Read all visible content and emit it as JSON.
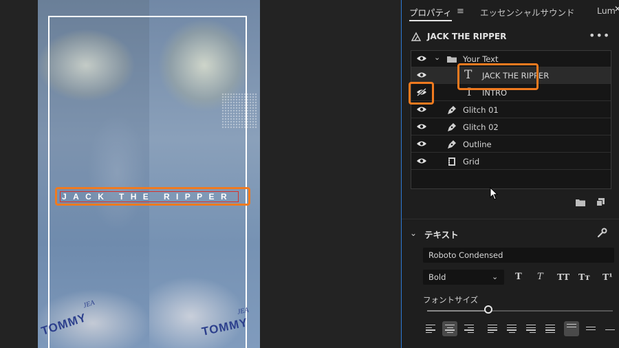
{
  "monitor": {
    "overlay_title": "JACK THE RIPPER",
    "shirt_brand_left": "TOMMY",
    "shirt_brand_right": "TOMMY",
    "shirt_sub_left": "JEA",
    "shirt_sub_right": "JEA"
  },
  "panel": {
    "tabs": [
      {
        "label": "プロパティ",
        "active": true
      },
      {
        "label": "エッセンシャルサウンド",
        "active": false
      },
      {
        "label": "Lum",
        "active": false
      }
    ],
    "tab_menu_icon": "hamburger-menu-icon",
    "tab_close_icon": "close-icon",
    "clip_name": "JACK THE RIPPER",
    "clip_more_label": "•••",
    "layers": [
      {
        "label": "Your Text",
        "type": "folder",
        "visible": true,
        "expanded": true,
        "selected": false
      },
      {
        "label": "JACK THE RIPPER",
        "type": "text",
        "visible": true,
        "selected": true
      },
      {
        "label": "INTRO",
        "type": "text",
        "visible": false,
        "selected": false
      },
      {
        "label": "Glitch 01",
        "type": "shape",
        "visible": true,
        "selected": false
      },
      {
        "label": "Glitch 02",
        "type": "shape",
        "visible": true,
        "selected": false
      },
      {
        "label": "Outline",
        "type": "shape",
        "visible": true,
        "selected": false
      },
      {
        "label": "Grid",
        "type": "clip",
        "visible": true,
        "selected": false
      }
    ],
    "text_section": {
      "title": "テキスト",
      "font_family": "Roboto Condensed",
      "font_style": "Bold",
      "format_buttons": [
        "T",
        "T",
        "TT",
        "Tт",
        "T¹"
      ],
      "font_size_label": "フォントサイズ",
      "font_size_level": 0.33,
      "align_active": [
        1,
        7
      ]
    },
    "accent_color": "#2d7bd6",
    "highlight_color": "#f07a1f"
  }
}
